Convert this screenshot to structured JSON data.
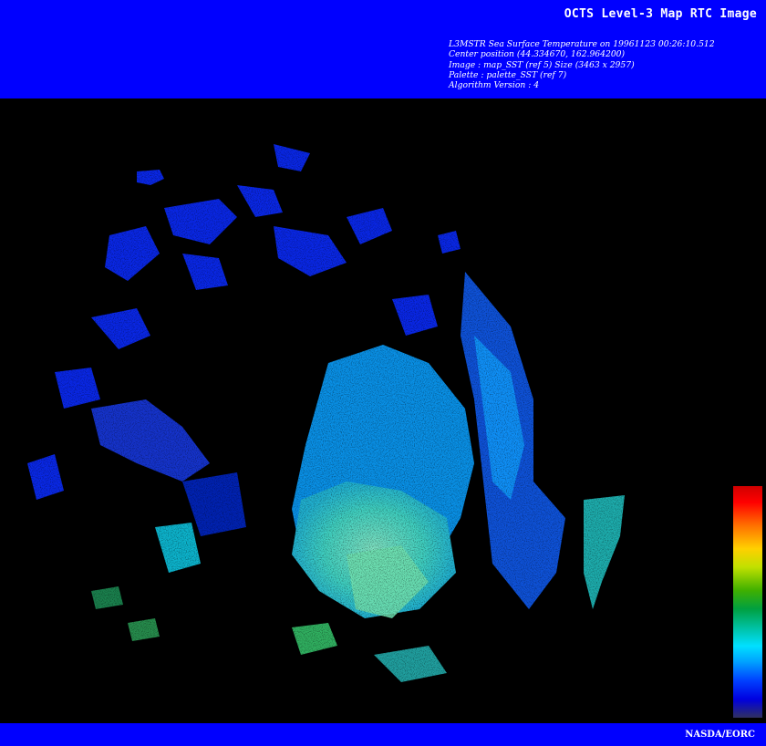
{
  "header": {
    "title": "OCTS Level-3 Map RTC Image",
    "meta_lines": [
      "L3MSTR Sea Surface Temperature on 19961123 00:26:10.512",
      "Center position (44.334670, 162.964200)",
      "Image : map_SST (ref 5) Size (3463 x 2957)",
      "Palette : palette_SST (ref 7)",
      "Algorithm Version : 4"
    ]
  },
  "footer": {
    "credit": "NASDA/EORC"
  },
  "colors": {
    "banner": "#0000ff",
    "background": "#000000",
    "text": "#ffffff"
  },
  "palette": {
    "name": "palette_SST",
    "orientation": "vertical",
    "order_top_to_bottom": [
      "red",
      "orange",
      "yellow",
      "green",
      "cyan",
      "blue",
      "dark-blue"
    ]
  }
}
